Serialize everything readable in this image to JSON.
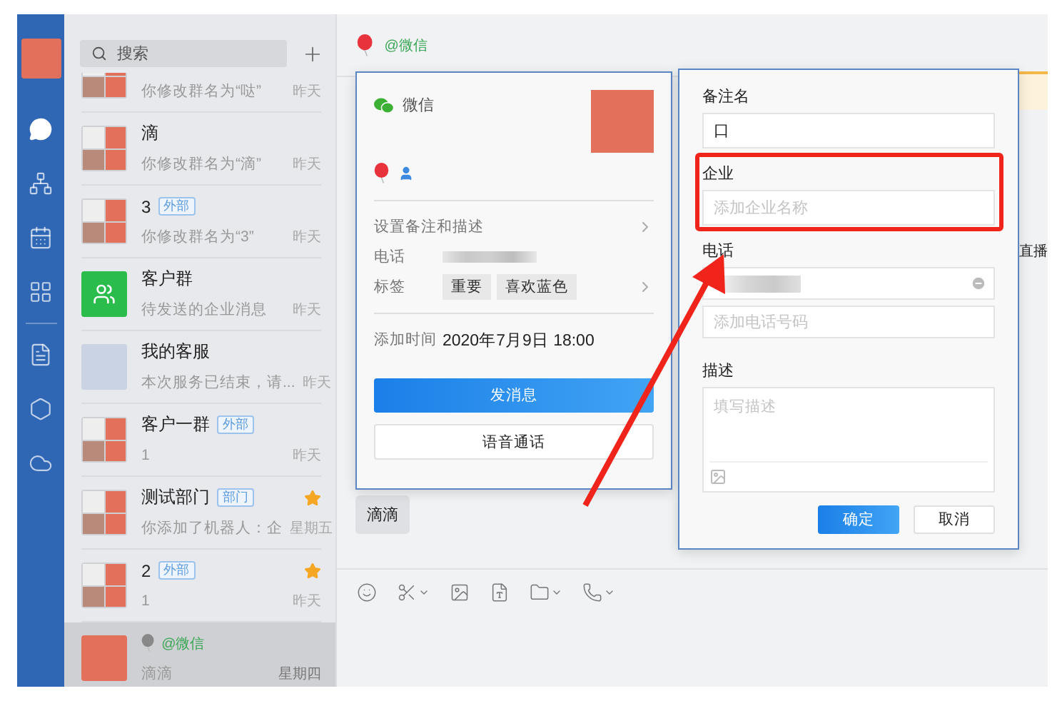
{
  "rail": {
    "items": [
      {
        "kind": "chat",
        "selected": true
      },
      {
        "kind": "org",
        "selected": false
      },
      {
        "kind": "calendar",
        "selected": false
      },
      {
        "kind": "apps",
        "selected": false
      },
      {
        "kind": "doc",
        "selected": false
      },
      {
        "kind": "hexagon",
        "selected": false
      },
      {
        "kind": "cloud",
        "selected": false
      }
    ]
  },
  "search": {
    "placeholder": "搜索"
  },
  "conversations": [
    {
      "kind": "group",
      "subtitle": "你修改群名为“哒”",
      "time": "昨天",
      "starred": false,
      "selected": false
    },
    {
      "kind": "group",
      "title": "滴",
      "subtitle": "你修改群名为“滴”",
      "time": "昨天",
      "starred": false,
      "selected": false
    },
    {
      "kind": "group",
      "title": "3",
      "badge": "外部",
      "subtitle": "你修改群名为“3”",
      "time": "昨天",
      "starred": false,
      "selected": false
    },
    {
      "kind": "contacts",
      "title": "客户群",
      "subtitle": "待发送的企业消息",
      "time": "昨天",
      "starred": false,
      "selected": false
    },
    {
      "kind": "photo",
      "title": "我的客服",
      "subtitle": "本次服务已结束，请...",
      "time": "昨天",
      "starred": false,
      "selected": false
    },
    {
      "kind": "group",
      "title": "客户一群",
      "badge": "外部",
      "subtitle": "1",
      "time": "昨天",
      "starred": false,
      "selected": false
    },
    {
      "kind": "group",
      "title": "测试部门",
      "badge": "部门",
      "subtitle": "你添加了机器人：企",
      "time": "星期五",
      "starred": true,
      "selected": false
    },
    {
      "kind": "group",
      "title": "2",
      "badge": "外部",
      "subtitle": "1",
      "time": "昨天",
      "starred": true,
      "selected": false
    },
    {
      "kind": "single",
      "title": "@微信",
      "subtitle": "滴滴",
      "time": "星期四",
      "starred": false,
      "selected": true
    }
  ],
  "chat": {
    "title": "@微信",
    "side_text": "直播",
    "bubble": "滴滴",
    "toolbar": [
      {
        "kind": "emoji",
        "menu": false
      },
      {
        "kind": "scissors",
        "menu": true
      },
      {
        "kind": "image",
        "menu": false
      },
      {
        "kind": "doc",
        "menu": false
      },
      {
        "kind": "folder",
        "menu": true
      },
      {
        "kind": "phone",
        "menu": true
      }
    ]
  },
  "profile_card": {
    "source": "微信",
    "rows": [
      {
        "kind": "link",
        "label": "设置备注和描述"
      },
      {
        "kind": "blurred",
        "label": "电话"
      },
      {
        "kind": "tags",
        "label": "标签",
        "tags": [
          "重要",
          "喜欢蓝色"
        ]
      }
    ],
    "added": {
      "label": "添加时间",
      "value": "2020年7月9日 18:00"
    },
    "buttons": [
      {
        "label": "发消息",
        "primary": true
      },
      {
        "label": "语音通话",
        "primary": false
      }
    ]
  },
  "edit_dialog": {
    "fields": [
      {
        "kind": "input",
        "label": "备注名",
        "value": "口",
        "highlighted": false
      },
      {
        "kind": "input",
        "label": "企业",
        "placeholder": "添加企业名称",
        "highlighted": true
      },
      {
        "kind": "phone",
        "label": "电话",
        "placeholder": "添加电话号码",
        "highlighted": false
      },
      {
        "kind": "textarea",
        "label": "描述",
        "placeholder": "填写描述",
        "highlighted": false
      }
    ],
    "buttons": [
      {
        "label": "确定",
        "primary": true
      },
      {
        "label": "取消",
        "primary": false
      }
    ]
  },
  "annotation_arrow": true
}
